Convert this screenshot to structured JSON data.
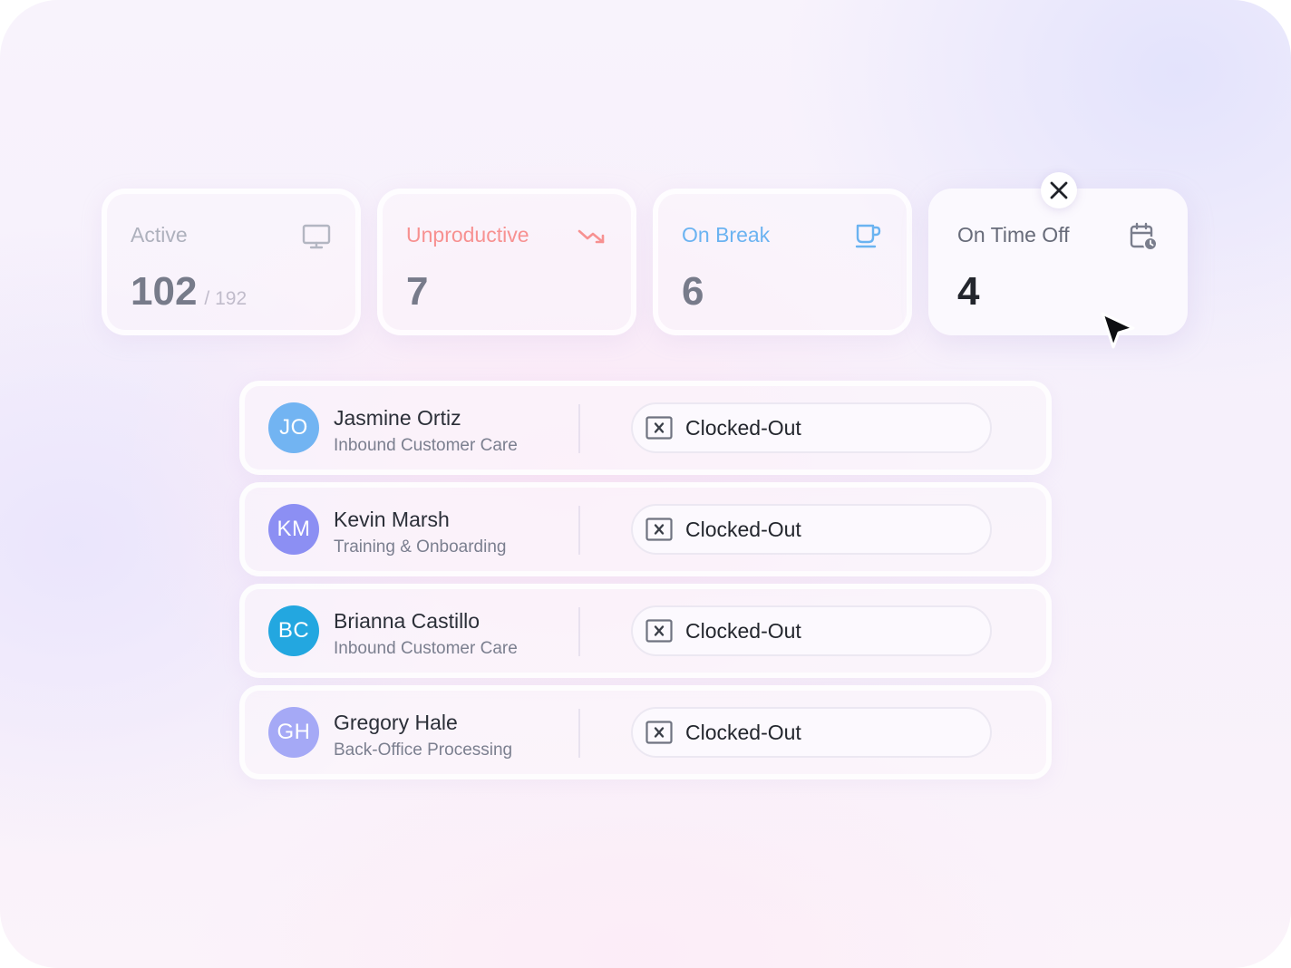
{
  "stats": {
    "cards": [
      {
        "label": "Active",
        "value": "102",
        "total": "/ 192",
        "icon": "monitor-icon",
        "label_color": "#aeb1bd",
        "value_color": "#777b8a"
      },
      {
        "label": "Unproductive",
        "value": "7",
        "icon": "trend-down-icon",
        "label_color": "#f79191",
        "value_color": "#777b8a"
      },
      {
        "label": "On Break",
        "value": "6",
        "icon": "coffee-cup-icon",
        "label_color": "#6bb3f1",
        "value_color": "#777b8a"
      },
      {
        "label": "On Time Off",
        "value": "4",
        "icon": "calendar-clock-icon",
        "label_color": "#676b79",
        "value_color": "#23262d",
        "selected": true
      }
    ]
  },
  "employees": [
    {
      "initials": "JO",
      "name": "Jasmine Ortiz",
      "department": "Inbound Customer Care",
      "status": "Clocked-Out",
      "avatar_color": "#72b4f2"
    },
    {
      "initials": "KM",
      "name": "Kevin Marsh",
      "department": "Training & Onboarding",
      "status": "Clocked-Out",
      "avatar_color": "#8c8ff3"
    },
    {
      "initials": "BC",
      "name": "Brianna Castillo",
      "department": "Inbound Customer Care",
      "status": "Clocked-Out",
      "avatar_color": "#23a7e0"
    },
    {
      "initials": "GH",
      "name": "Gregory Hale",
      "department": "Back-Office Processing",
      "status": "Clocked-Out",
      "avatar_color": "#a5a9f6"
    }
  ],
  "icons": {
    "close": "close-icon",
    "cursor": "cursor-arrow-icon",
    "status": "clocked-out-icon"
  }
}
